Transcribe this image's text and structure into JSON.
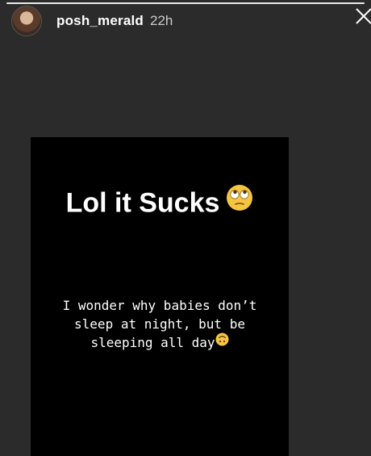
{
  "story": {
    "progress": 1.0
  },
  "header": {
    "username": "posh_merald",
    "timestamp": "22h",
    "avatar_icon": "profile-photo",
    "close_icon": "close-icon"
  },
  "card": {
    "headline": "Lol it Sucks",
    "headline_emoji": "face-with-rolling-eyes-icon",
    "body_lines": [
      "I wonder why babies don’t",
      "sleep at night, but be",
      "sleeping all day"
    ],
    "body_emoji": "upside-down-face-icon"
  },
  "colors": {
    "background": "#2b2b2b",
    "card": "#000000",
    "text": "#ffffff",
    "emoji_yellow": "#f5c542"
  }
}
